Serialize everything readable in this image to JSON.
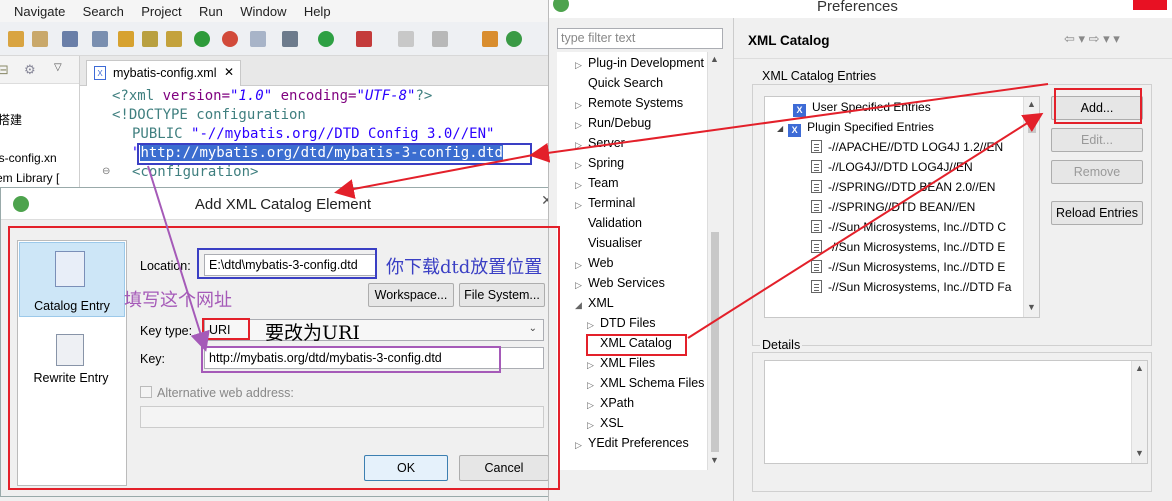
{
  "eclipse": {
    "menu": [
      "Navigate",
      "Search",
      "Project",
      "Run",
      "Window",
      "Help"
    ],
    "left_pane_lines": [
      "搭建",
      "itis-config.xn",
      "em Library ["
    ],
    "editor_tab": "mybatis-config.xml",
    "code": {
      "line1_a": "<?xml ",
      "line1_b": "version=",
      "line1_c": "\"1.0\" ",
      "line1_d": "encoding=",
      "line1_e": "\"UTF-8\"",
      "line1_f": "?>",
      "line2": "<!DOCTYPE configuration",
      "line3_a": "PUBLIC ",
      "line3_b": "\"-//mybatis.org//DTD Config 3.0//EN\"",
      "line4_url": "http://mybatis.org/dtd/mybatis-3-config.dtd",
      "line5": "<configuration>"
    }
  },
  "dialog": {
    "title": "Add XML Catalog Element",
    "side_items": [
      "Catalog Entry",
      "Rewrite Entry"
    ],
    "location_label": "Location:",
    "location_value": "E:\\dtd\\mybatis-3-config.dtd",
    "workspace_button": "Workspace...",
    "filesystem_button": "File System...",
    "key_type_label": "Key type:",
    "key_type_value": "URI",
    "key_label": "Key:",
    "key_value": "http://mybatis.org/dtd/mybatis-3-config.dtd",
    "alt_address_label": "Alternative web address:",
    "ok_button": "OK",
    "cancel_button": "Cancel"
  },
  "annotations": {
    "dtd_location": "你下载dtd放置位置",
    "fill_url": "填写这个网址",
    "change_uri": "要改为URI"
  },
  "preferences": {
    "title": "Preferences",
    "filter_placeholder": "type filter text",
    "tree": [
      {
        "label": "Plug-in Development",
        "arrow": "▷"
      },
      {
        "label": "Quick Search",
        "arrow": ""
      },
      {
        "label": "Remote Systems",
        "arrow": "▷"
      },
      {
        "label": "Run/Debug",
        "arrow": "▷"
      },
      {
        "label": "Server",
        "arrow": "▷"
      },
      {
        "label": "Spring",
        "arrow": "▷"
      },
      {
        "label": "Team",
        "arrow": "▷"
      },
      {
        "label": "Terminal",
        "arrow": "▷"
      },
      {
        "label": "Validation",
        "arrow": ""
      },
      {
        "label": "Visualiser",
        "arrow": ""
      },
      {
        "label": "Web",
        "arrow": "▷"
      },
      {
        "label": "Web Services",
        "arrow": "▷"
      },
      {
        "label": "XML",
        "arrow": "◢"
      }
    ],
    "xml_children": [
      "DTD Files",
      "XML Catalog",
      "XML Files",
      "XML Schema Files",
      "XPath",
      "XSL"
    ],
    "tree_last": "YEdit Preferences",
    "page_title": "XML Catalog",
    "entries_group": "XML Catalog Entries",
    "user_entries": "User Specified Entries",
    "plugin_entries": "Plugin Specified Entries",
    "entries": [
      "-//APACHE//DTD LOG4J 1.2//EN",
      "-//LOG4J//DTD LOG4J//EN",
      "-//SPRING//DTD BEAN 2.0//EN",
      "-//SPRING//DTD BEAN//EN",
      "-//Sun Microsystems, Inc.//DTD C",
      "-//Sun Microsystems, Inc.//DTD E",
      "-//Sun Microsystems, Inc.//DTD E",
      "-//Sun Microsystems, Inc.//DTD Fa"
    ],
    "add_button": "Add...",
    "edit_button": "Edit...",
    "remove_button": "Remove",
    "reload_button": "Reload Entries",
    "details_label": "Details"
  },
  "colors": {
    "red": "#e3202a",
    "blue": "#3a3fc4",
    "purple": "#a55ab8",
    "selection": "#3b6dd0"
  }
}
